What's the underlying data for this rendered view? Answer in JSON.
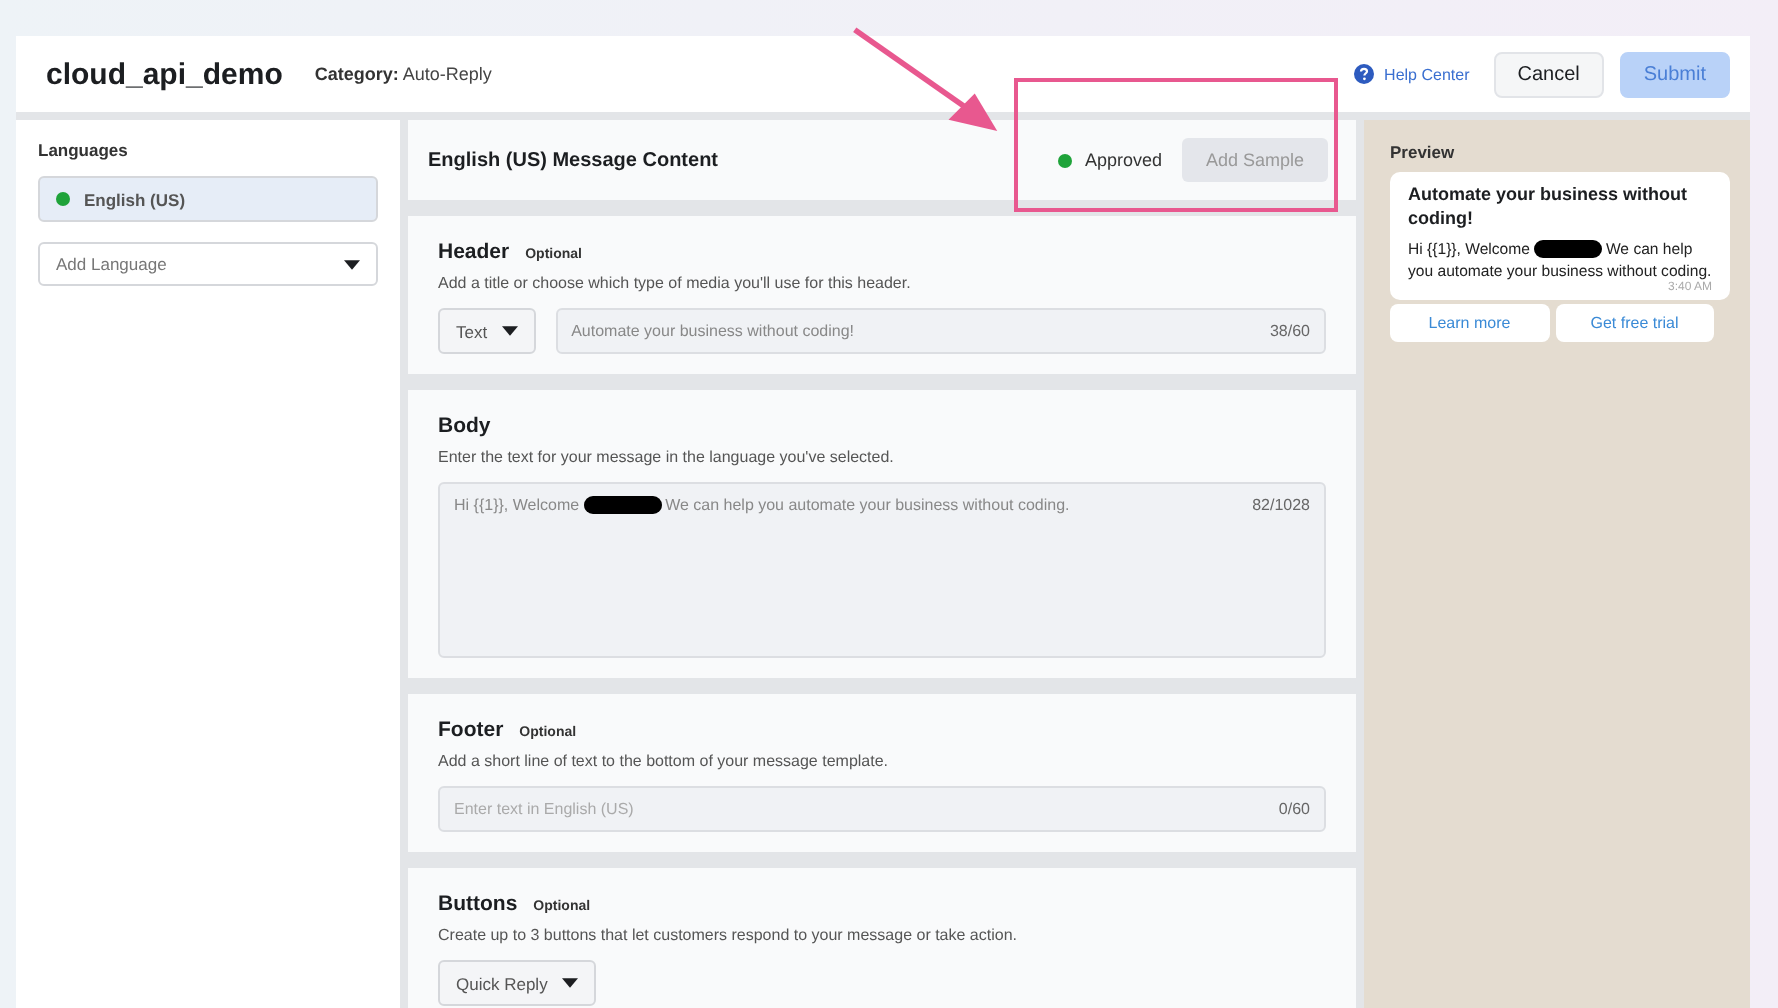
{
  "app_bar": {
    "title": "cloud_api_demo",
    "category_label": "Category:",
    "category": "Auto-Reply",
    "help": "Help Center",
    "buttons": [
      {
        "label": "Cancel",
        "disabled": false
      },
      {
        "label": "Submit",
        "disabled": true
      }
    ]
  },
  "languages": {
    "title": "Languages",
    "items": [
      {
        "label": "English (US)",
        "selected": true,
        "color": "#1fa33a"
      }
    ],
    "add": {
      "placeholder": "Add Language"
    }
  },
  "content": {
    "title": "English (US) Message Content",
    "status": {
      "label": "Approved",
      "color": "#1fa33a"
    },
    "add_sample": {
      "label": "Add Sample",
      "disabled": true
    },
    "sections": [
      {
        "kind": "input",
        "title": "Header",
        "tag": "Optional",
        "hint": "Add a title or choose which type of media you'll use for this header.",
        "type_select": "Text",
        "value": "Automate your business without coding!",
        "counter": "38/60"
      },
      {
        "kind": "textarea",
        "title": "Body",
        "hint": "Enter the text for your message in the language you've selected.",
        "value_before": "Hi {{1}}, Welcome",
        "redacted": true,
        "value_after": "We can help you automate your business without coding.",
        "counter": "82/1028"
      },
      {
        "kind": "input",
        "title": "Footer",
        "tag": "Optional",
        "hint": "Add a short line of text to the bottom of your message template.",
        "placeholder": "Enter text in English (US)",
        "counter": "0/60"
      },
      {
        "kind": "select",
        "title": "Buttons",
        "tag": "Optional",
        "hint": "Create up to 3 buttons that let customers respond to your message or take action.",
        "type_select": "Quick Reply"
      }
    ]
  },
  "preview": {
    "title": "Preview",
    "message": {
      "heading": "Automate your business without coding!",
      "text_before": "Hi {{1}}, Welcome",
      "redacted": true,
      "text_after": "We can help",
      "text_rest": "you automate your business without coding.",
      "time": "3:40 AM"
    },
    "buttons": [
      "Learn more",
      "Get free trial"
    ]
  }
}
